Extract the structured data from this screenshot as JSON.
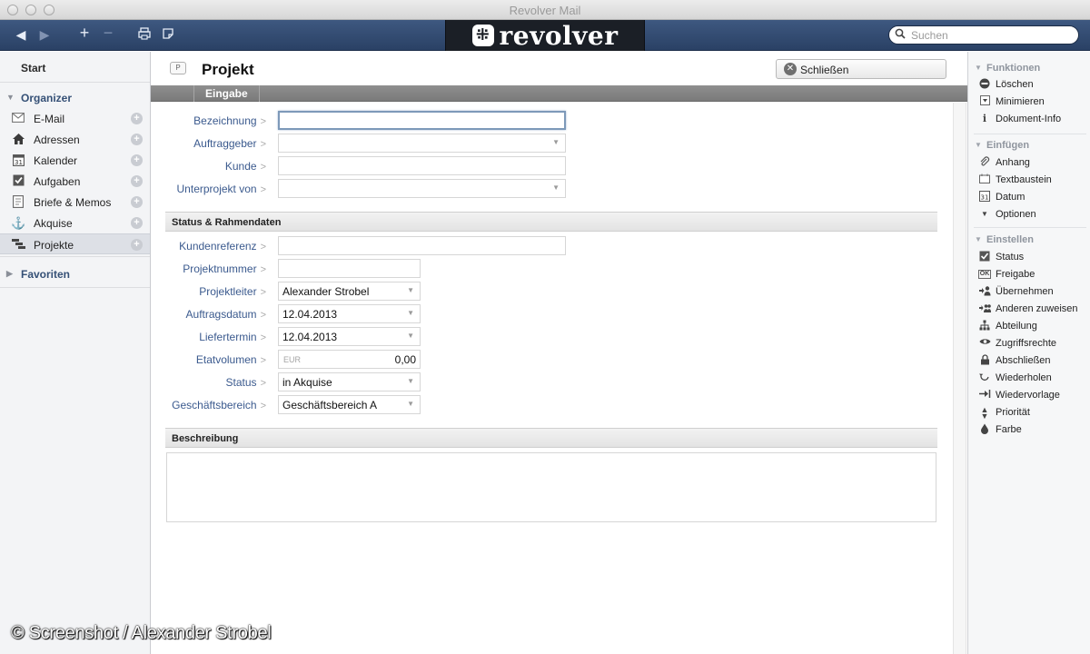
{
  "window": {
    "title": "Revolver Mail"
  },
  "toolbar": {
    "logo_text": "revolver",
    "search_placeholder": "Suchen"
  },
  "sidebar": {
    "start": "Start",
    "organizer_label": "Organizer",
    "items": [
      {
        "label": "E-Mail",
        "icon": "mail-icon"
      },
      {
        "label": "Adressen",
        "icon": "house-icon"
      },
      {
        "label": "Kalender",
        "icon": "calendar-icon"
      },
      {
        "label": "Aufgaben",
        "icon": "checkbox-icon"
      },
      {
        "label": "Briefe & Memos",
        "icon": "document-icon"
      },
      {
        "label": "Akquise",
        "icon": "anchor-icon"
      },
      {
        "label": "Projekte",
        "icon": "project-icon"
      }
    ],
    "active_item": "Projekte",
    "favorites_label": "Favoriten"
  },
  "document": {
    "badge": "P",
    "title": "Projekt",
    "close_label": "Schließen",
    "tab_label": "Eingabe",
    "fields_top": [
      {
        "label": "Bezeichnung",
        "value": "",
        "type": "text"
      },
      {
        "label": "Auftraggeber",
        "value": "",
        "type": "select"
      },
      {
        "label": "Kunde",
        "value": "",
        "type": "text"
      },
      {
        "label": "Unterprojekt von",
        "value": "",
        "type": "select"
      }
    ],
    "status_section_title": "Status & Rahmendaten",
    "fields_status": [
      {
        "label": "Kundenreferenz",
        "value": ""
      },
      {
        "label": "Projektnummer",
        "value": ""
      },
      {
        "label": "Projektleiter",
        "value": "Alexander Strobel"
      },
      {
        "label": "Auftragsdatum",
        "value": "12.04.2013"
      },
      {
        "label": "Liefertermin",
        "value": "12.04.2013"
      },
      {
        "label": "Etatvolumen",
        "currency": "EUR",
        "value": "0,00"
      },
      {
        "label": "Status",
        "value": "in Akquise"
      },
      {
        "label": "Geschäftsbereich",
        "value": "Geschäftsbereich A"
      }
    ],
    "description_section_title": "Beschreibung",
    "field_arrow": ">"
  },
  "right_panel": {
    "functions_label": "Funktionen",
    "functions": [
      {
        "label": "Löschen",
        "icon": "minus-circle-icon"
      },
      {
        "label": "Minimieren",
        "icon": "minimize-icon"
      },
      {
        "label": "Dokument-Info",
        "icon": "info-icon"
      }
    ],
    "insert_label": "Einfügen",
    "insert": [
      {
        "label": "Anhang",
        "icon": "paperclip-icon"
      },
      {
        "label": "Textbaustein",
        "icon": "text-block-icon"
      },
      {
        "label": "Datum",
        "icon": "calendar-icon"
      },
      {
        "label": "Optionen",
        "icon": "triangle-down-icon"
      }
    ],
    "settings_label": "Einstellen",
    "settings": [
      {
        "label": "Status",
        "icon": "checkbox-icon"
      },
      {
        "label": "Freigabe",
        "icon": "ok-icon"
      },
      {
        "label": "Übernehmen",
        "icon": "take-over-icon"
      },
      {
        "label": "Anderen zuweisen",
        "icon": "assign-icon"
      },
      {
        "label": "Abteilung",
        "icon": "department-icon"
      },
      {
        "label": "Zugriffsrechte",
        "icon": "eye-icon"
      },
      {
        "label": "Abschließen",
        "icon": "lock-icon"
      },
      {
        "label": "Wiederholen",
        "icon": "repeat-icon"
      },
      {
        "label": "Wiedervorlage",
        "icon": "resubmit-icon"
      },
      {
        "label": "Priorität",
        "icon": "priority-icon"
      },
      {
        "label": "Farbe",
        "icon": "color-drop-icon"
      }
    ]
  },
  "watermark": "© Screenshot / Alexander Strobel"
}
